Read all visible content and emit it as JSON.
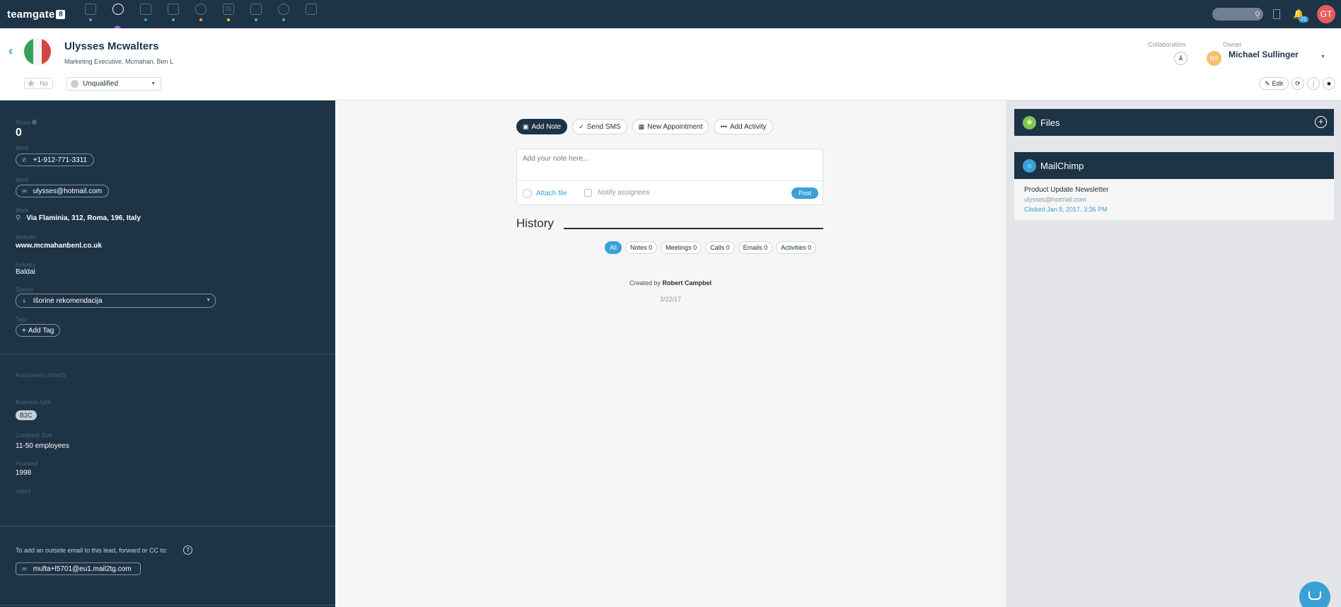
{
  "topbar": {
    "brand": "teamgate",
    "brand_badge": "8",
    "nav_items": [
      {
        "name": "dashboard-icon",
        "dot": "#6f8cf6",
        "active": false
      },
      {
        "name": "leads-icon",
        "dot": "#9b59d6",
        "active": true
      },
      {
        "name": "deals-icon",
        "dot": "#3aa0d6",
        "active": false
      },
      {
        "name": "contacts-icon",
        "dot": "#3fbf7f",
        "active": false
      },
      {
        "name": "tasks-icon",
        "dot": "#f5a623",
        "active": false
      },
      {
        "name": "calendar-icon",
        "dot": "#f5c823",
        "active": false
      },
      {
        "name": "upload-icon",
        "dot": "#3fbf7f",
        "active": false
      },
      {
        "name": "documents-icon",
        "dot": "#3fbf7f",
        "active": false
      },
      {
        "name": "reports-icon",
        "dot": "#1d3346",
        "active": false
      }
    ],
    "calendar_day": "20",
    "notif_count": "21",
    "user_initials": "GT"
  },
  "header": {
    "back": "‹",
    "name": "Ulysses Mcwalters",
    "subtitle": "Marketing Executive, Mcmahan, Ben L",
    "star_label": "No",
    "status": "Unqualified",
    "collaborators_label": "Collaborators",
    "owner_label": "Owner",
    "owner_initials": "MS",
    "owner_name": "Michael Sullinger",
    "edit_label": "Edit"
  },
  "lead": {
    "score_label": "Score",
    "score": "0",
    "phone_label": "Work",
    "phone": "+1-912-771-3311",
    "email_label": "Work",
    "email": "ulysses@hotmail.com",
    "address_label": "Work",
    "address": "Via Flaminia, 312, Roma, 196, Italy",
    "website_label": "Website",
    "website": "www.mcmahanbenl.co.uk",
    "industry_label": "Industry",
    "industry": "Baldai",
    "source_label": "Source",
    "source": "Išorinė rekomendacija",
    "tags_label": "Tags",
    "add_tag": "Add Tag",
    "associated_label": "Associated contacts",
    "business_type_label": "Business type",
    "business_type": "B2C",
    "company_size_label": "Company Size",
    "company_size": "11-50 employees",
    "founded_label": "Founded",
    "founded": "1998",
    "colors_label": "colors",
    "forward_hint": "To add an outside email to this lead, forward or CC to:",
    "forward_email": "mufta+l5701@eu1.mail2tg.com"
  },
  "activity": {
    "tabs": [
      "Add Note",
      "Send SMS",
      "New Appointment",
      "Add Activity"
    ],
    "note_placeholder": "Add your note here...",
    "attach": "Attach file",
    "notify": "Notify assignees",
    "post": "Post",
    "history_title": "History",
    "filters": [
      "All",
      "Notes 0",
      "Meetings 0",
      "Calls 0",
      "Emails 0",
      "Activities 0"
    ],
    "created_prefix": "Created by",
    "created_by": "Robert Campbel",
    "created_date": "3/22/17"
  },
  "files": {
    "title": "Files"
  },
  "mailchimp": {
    "title": "MailChimp",
    "campaign": "Product Update Newsletter",
    "email": "ulysses@hotmail.com",
    "clicked": "Clicked Jan 9, 2017, 3:36 PM"
  },
  "colors": {
    "nav": "#1d3346",
    "accent": "#3aa0d6",
    "owner_avatar": "#f5c06b",
    "user_avatar": "#e55c5c"
  }
}
